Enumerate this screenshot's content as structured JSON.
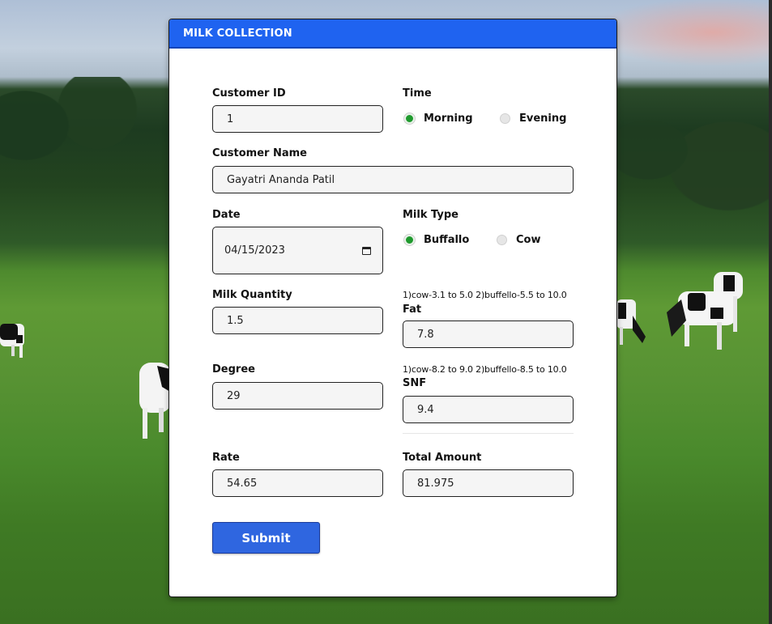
{
  "form": {
    "title": "MILK COLLECTION",
    "customer_id": {
      "label": "Customer ID",
      "value": "1"
    },
    "time": {
      "label": "Time",
      "options": [
        "Morning",
        "Evening"
      ],
      "selected": "Morning"
    },
    "customer_name": {
      "label": "Customer Name",
      "value": "Gayatri Ananda Patil"
    },
    "date": {
      "label": "Date",
      "value": "04/15/2023"
    },
    "milk_type": {
      "label": "Milk Type",
      "options": [
        "Buffallo",
        "Cow"
      ],
      "selected": "Buffallo"
    },
    "milk_quantity": {
      "label": "Milk Quantity",
      "value": "1.5"
    },
    "fat": {
      "hint": "1)cow-3.1 to 5.0 2)buffello-5.5 to 10.0",
      "label": "Fat",
      "value": "7.8"
    },
    "degree": {
      "label": "Degree",
      "value": "29"
    },
    "snf": {
      "hint": "1)cow-8.2 to 9.0 2)buffello-8.5 to 10.0",
      "label": "SNF",
      "value": "9.4"
    },
    "rate": {
      "label": "Rate",
      "value": "54.65"
    },
    "total_amount": {
      "label": "Total Amount",
      "value": "81.975"
    },
    "submit_label": "Submit"
  },
  "colors": {
    "header": "#1f63f0",
    "submit": "#2f66e0",
    "radio_selected": "#1f9a2e"
  }
}
